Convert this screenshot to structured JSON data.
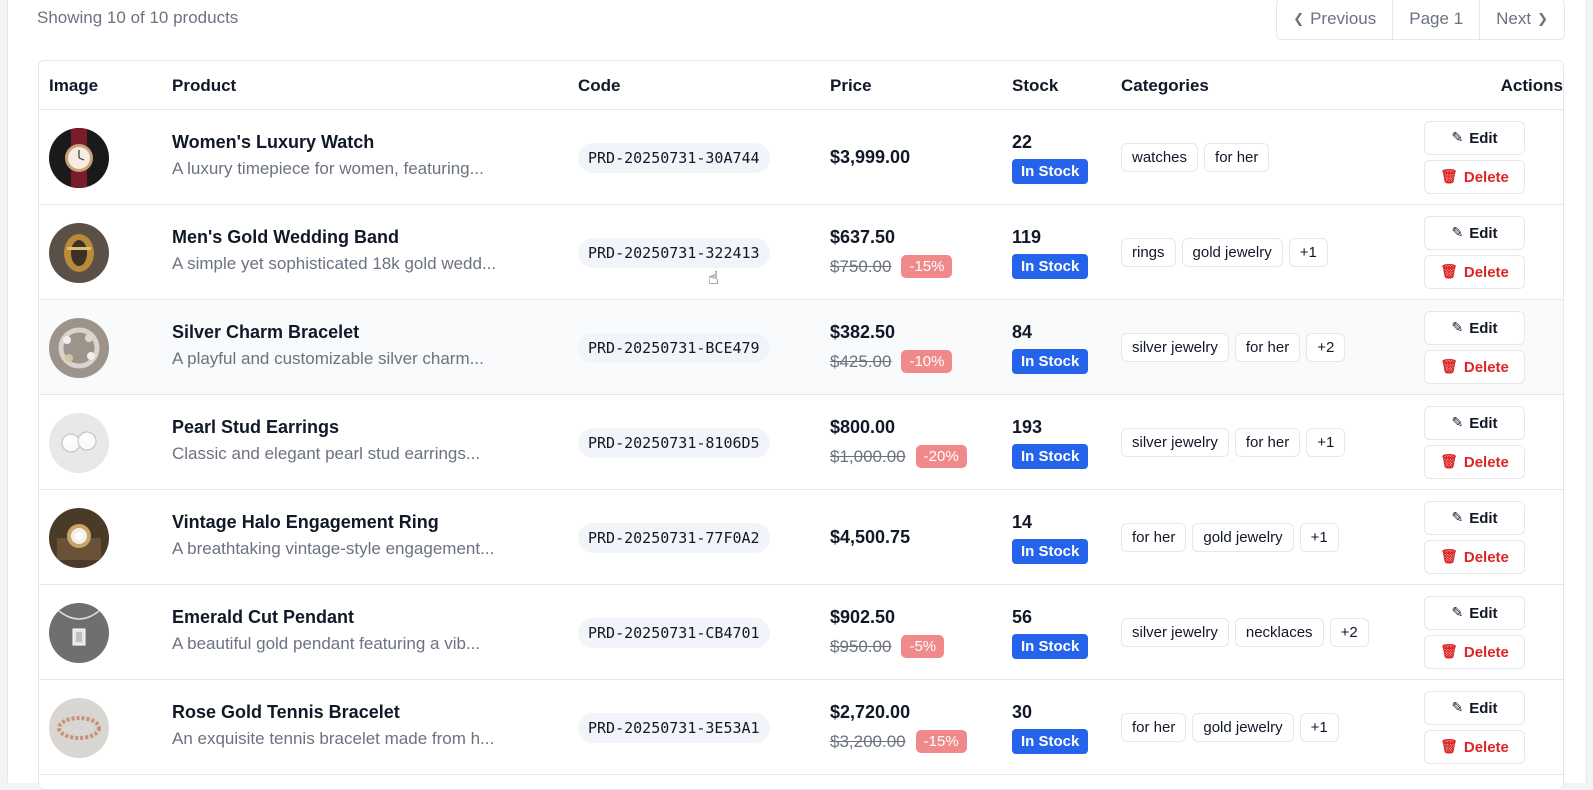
{
  "summary": "Showing 10 of 10 products",
  "pagination": {
    "prev": "Previous",
    "page": "Page 1",
    "next": "Next"
  },
  "columns": [
    "Image",
    "Product",
    "Code",
    "Price",
    "Stock",
    "Categories",
    "Actions"
  ],
  "actions": {
    "edit": "Edit",
    "delete": "Delete"
  },
  "colors": {
    "stock_badge": "#2563eb",
    "discount_badge": "#f08a8a",
    "delete": "#dc2626",
    "code_bg": "#f1f5f9"
  },
  "products": [
    {
      "name": "Women's Luxury Watch",
      "desc": "A luxury timepiece for women, featuring...",
      "code": "PRD-20250731-30A744",
      "price": "$3,999.00",
      "old_price": "",
      "discount": "",
      "qty": "22",
      "stock": "In Stock",
      "categories": [
        "watches",
        "for her"
      ],
      "thumb": "watch"
    },
    {
      "name": "Men's Gold Wedding Band",
      "desc": "A simple yet sophisticated 18k gold wedd...",
      "code": "PRD-20250731-322413",
      "price": "$637.50",
      "old_price": "$750.00",
      "discount": "-15%",
      "qty": "119",
      "stock": "In Stock",
      "categories": [
        "rings",
        "gold jewelry",
        "+1"
      ],
      "thumb": "ring"
    },
    {
      "name": "Silver Charm Bracelet",
      "desc": "A playful and customizable silver charm...",
      "code": "PRD-20250731-BCE479",
      "price": "$382.50",
      "old_price": "$425.00",
      "discount": "-10%",
      "qty": "84",
      "stock": "In Stock",
      "categories": [
        "silver jewelry",
        "for her",
        "+2"
      ],
      "thumb": "bracelet"
    },
    {
      "name": "Pearl Stud Earrings",
      "desc": "Classic and elegant pearl stud earrings...",
      "code": "PRD-20250731-8106D5",
      "price": "$800.00",
      "old_price": "$1,000.00",
      "discount": "-20%",
      "qty": "193",
      "stock": "In Stock",
      "categories": [
        "silver jewelry",
        "for her",
        "+1"
      ],
      "thumb": "pearls"
    },
    {
      "name": "Vintage Halo Engagement Ring",
      "desc": "A breathtaking vintage-style engagement...",
      "code": "PRD-20250731-77F0A2",
      "price": "$4,500.75",
      "old_price": "",
      "discount": "",
      "qty": "14",
      "stock": "In Stock",
      "categories": [
        "for her",
        "gold jewelry",
        "+1"
      ],
      "thumb": "halo"
    },
    {
      "name": "Emerald Cut Pendant",
      "desc": "A beautiful gold pendant featuring a vib...",
      "code": "PRD-20250731-CB4701",
      "price": "$902.50",
      "old_price": "$950.00",
      "discount": "-5%",
      "qty": "56",
      "stock": "In Stock",
      "categories": [
        "silver jewelry",
        "necklaces",
        "+2"
      ],
      "thumb": "pendant"
    },
    {
      "name": "Rose Gold Tennis Bracelet",
      "desc": "An exquisite tennis bracelet made from h...",
      "code": "PRD-20250731-3E53A1",
      "price": "$2,720.00",
      "old_price": "$3,200.00",
      "discount": "-15%",
      "qty": "30",
      "stock": "In Stock",
      "categories": [
        "for her",
        "gold jewelry",
        "+1"
      ],
      "thumb": "tennis"
    }
  ]
}
